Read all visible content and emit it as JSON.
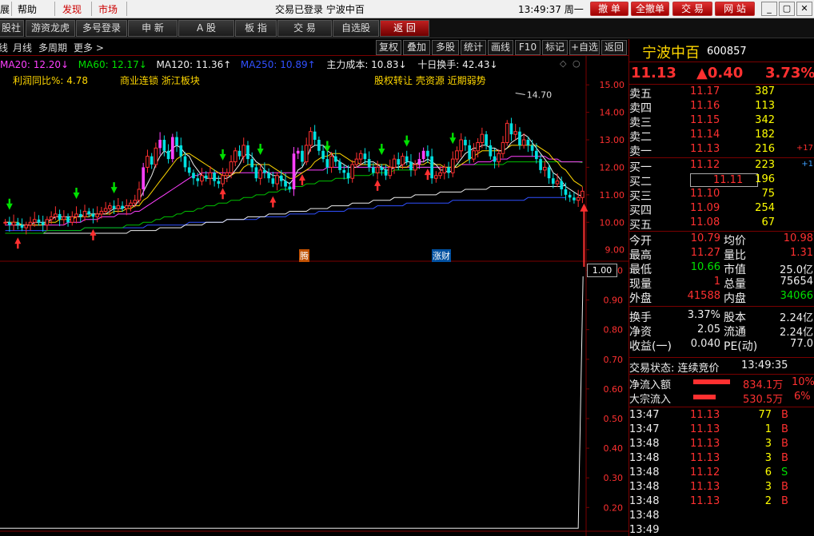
{
  "menu": {
    "items": [
      "展",
      "帮助",
      "发现",
      "市场"
    ],
    "window_title": "交易已登录  宁波中百",
    "clock": "13:49:37 周一",
    "trade_buttons": [
      "撤 单",
      "全撤单",
      "交 易",
      "网 站"
    ],
    "window_controls": [
      "_",
      "▢",
      "✕"
    ]
  },
  "toolbar": {
    "buttons": [
      "股社",
      "游资龙虎",
      "多号登录",
      "申 新",
      "A 股",
      "板 指",
      "交 易",
      "自选股",
      "返 回"
    ],
    "active_index": 8
  },
  "chart_toolbar": {
    "period_items": [
      "线",
      "月线",
      "多周期",
      "更多 >"
    ],
    "tool_buttons": [
      "复权",
      "叠加",
      "多股",
      "统计",
      "画线",
      "F10",
      "标记",
      "+自选",
      "返回"
    ]
  },
  "ma_legend": [
    {
      "text": "MA20: 12.20↓",
      "color": "#ff40ff"
    },
    {
      "text": "MA60: 12.17↓",
      "color": "#00e000"
    },
    {
      "text": "MA120: 11.36↑",
      "color": "#eeeeee"
    },
    {
      "text": "MA250: 10.89↑",
      "color": "#3050ff"
    },
    {
      "text": "主力成本: 10.83↓",
      "color": "#eeeeee"
    },
    {
      "text": "十日换手: 42.43↓",
      "color": "#eeeeee"
    }
  ],
  "info_line": {
    "left": "利润同比%: 4.78",
    "middle": "商业连锁 浙江板块",
    "right": "股权转让 壳资源 近期弱势"
  },
  "peak_label": "14.70",
  "price_axis": [
    "15.00",
    "14.00",
    "13.00",
    "12.00",
    "11.00",
    "10.00",
    "9.00"
  ],
  "lower_axis": [
    "1.00",
    "0.90",
    "0.80",
    "0.70",
    "0.60",
    "0.50",
    "0.40",
    "0.30",
    "0.20"
  ],
  "lower_axis_current": "1.00",
  "event_tags": [
    "腾",
    "涨财"
  ],
  "chart_data": {
    "type": "line",
    "title": "",
    "price_range": [
      8.7,
      15.5
    ],
    "x": [
      "d1",
      "d2",
      "d3",
      "d4",
      "d5",
      "d6",
      "d7",
      "d8",
      "d9",
      "d10",
      "d11",
      "d12",
      "d13",
      "d14",
      "d15",
      "d16",
      "d17",
      "d18",
      "d19",
      "d20",
      "d21",
      "d22",
      "d23",
      "d24",
      "d25",
      "d26",
      "d27",
      "d28",
      "d29",
      "d30",
      "d31",
      "d32",
      "d33",
      "d34",
      "d35",
      "d36",
      "d37",
      "d38",
      "d39",
      "d40",
      "d41",
      "d42",
      "d43",
      "d44",
      "d45",
      "d46",
      "d47",
      "d48",
      "d49",
      "d50",
      "d51",
      "d52",
      "d53",
      "d54",
      "d55",
      "d56",
      "d57",
      "d58",
      "d59",
      "d60",
      "d61",
      "d62",
      "d63",
      "d64",
      "d65",
      "d66",
      "d67",
      "d68",
      "d69",
      "d70",
      "d71",
      "d72",
      "d73",
      "d74",
      "d75",
      "d76",
      "d77",
      "d78",
      "d79",
      "d80",
      "d81",
      "d82",
      "d83",
      "d84",
      "d85",
      "d86",
      "d87",
      "d88",
      "d89",
      "d90",
      "d91",
      "d92",
      "d93",
      "d94",
      "d95",
      "d96",
      "d97",
      "d98",
      "d99",
      "d100",
      "d101",
      "d102",
      "d103",
      "d104",
      "d105",
      "d106",
      "d107",
      "d108",
      "d109",
      "d110",
      "d111",
      "d112",
      "d113",
      "d114",
      "d115",
      "d116",
      "d117",
      "d118",
      "d119",
      "d120",
      "d121",
      "d122",
      "d123",
      "d124",
      "d125",
      "d126",
      "d127",
      "d128",
      "d129",
      "d130",
      "d131",
      "d132",
      "d133",
      "d134",
      "d135",
      "d136",
      "d137",
      "d138",
      "d139"
    ],
    "close": [
      10.0,
      9.9,
      10.0,
      9.9,
      9.8,
      9.9,
      10.0,
      10.1,
      10.0,
      9.9,
      10.1,
      10.2,
      10.3,
      10.1,
      10.2,
      10.0,
      10.2,
      10.3,
      10.2,
      10.4,
      10.3,
      10.2,
      10.3,
      10.4,
      10.5,
      10.6,
      10.5,
      10.6,
      10.5,
      10.6,
      10.7,
      10.8,
      11.2,
      12.0,
      12.4,
      12.1,
      12.7,
      13.0,
      12.6,
      12.3,
      13.1,
      12.8,
      12.4,
      12.0,
      11.8,
      11.6,
      11.5,
      11.7,
      11.6,
      11.8,
      11.5,
      11.4,
      11.7,
      11.8,
      12.2,
      12.6,
      12.4,
      12.8,
      12.3,
      12.0,
      11.6,
      11.9,
      11.8,
      11.6,
      11.4,
      11.7,
      11.5,
      11.3,
      11.2,
      12.5,
      12.6,
      12.2,
      12.8,
      13.3,
      13.0,
      12.6,
      12.3,
      12.0,
      12.4,
      12.2,
      11.9,
      11.8,
      11.6,
      12.1,
      12.3,
      12.5,
      12.3,
      12.0,
      11.8,
      12.0,
      11.9,
      11.7,
      12.0,
      12.3,
      12.1,
      12.4,
      12.2,
      11.9,
      12.1,
      12.3,
      12.6,
      12.4,
      11.6,
      11.7,
      11.8,
      12.0,
      11.8,
      12.3,
      12.6,
      13.0,
      12.8,
      12.3,
      12.6,
      12.9,
      13.2,
      12.8,
      12.4,
      12.2,
      12.5,
      12.9,
      13.6,
      13.2,
      13.3,
      12.8,
      13.0,
      12.8,
      12.6,
      12.3,
      11.9,
      12.0,
      11.6,
      11.4,
      11.5,
      11.2,
      11.0,
      10.9,
      10.8,
      10.9,
      11.13
    ],
    "limit_up_days": [
      33,
      37,
      40,
      69,
      70,
      99,
      100
    ],
    "ma5": [
      10.0,
      10.0,
      9.9,
      9.9,
      9.9,
      9.9,
      9.9,
      10.0,
      10.0,
      10.0,
      10.0,
      10.1,
      10.2,
      10.2,
      10.2,
      10.2,
      10.2,
      10.2,
      10.2,
      10.3,
      10.3,
      10.3,
      10.3,
      10.3,
      10.3,
      10.4,
      10.5,
      10.5,
      10.5,
      10.6,
      10.6,
      10.6,
      10.8,
      11.1,
      11.4,
      11.7,
      12.1,
      12.4,
      12.6,
      12.5,
      12.7,
      12.8,
      12.7,
      12.5,
      12.4,
      12.1,
      11.9,
      11.7,
      11.6,
      11.6,
      11.6,
      11.6,
      11.6,
      11.6,
      11.7,
      11.9,
      12.1,
      12.4,
      12.5,
      12.4,
      12.2,
      12.1,
      11.9,
      11.8,
      11.7,
      11.7,
      11.6,
      11.5,
      11.4,
      11.6,
      11.9,
      12.0,
      12.3,
      12.7,
      12.8,
      12.8,
      12.8,
      12.6,
      12.5,
      12.3,
      12.2,
      12.1,
      12.0,
      12.0,
      12.0,
      12.1,
      12.2,
      12.2,
      12.2,
      12.1,
      12.0,
      11.9,
      11.9,
      12.0,
      12.0,
      12.1,
      12.2,
      12.2,
      12.1,
      12.2,
      12.2,
      12.3,
      12.2,
      12.1,
      11.9,
      11.9,
      11.8,
      11.9,
      12.1,
      12.3,
      12.5,
      12.6,
      12.7,
      12.7,
      12.8,
      12.8,
      12.7,
      12.7,
      12.6,
      12.6,
      12.7,
      12.9,
      13.0,
      13.1,
      13.2,
      13.1,
      12.9,
      12.7,
      12.5,
      12.3,
      12.1,
      11.8,
      11.7,
      11.5,
      11.3,
      11.2,
      11.1,
      11.0,
      10.95
    ],
    "ma10": [
      10.0,
      10.0,
      10.0,
      10.0,
      9.9,
      9.9,
      9.9,
      9.9,
      9.9,
      9.9,
      10.0,
      10.0,
      10.0,
      10.1,
      10.1,
      10.1,
      10.1,
      10.2,
      10.2,
      10.2,
      10.2,
      10.3,
      10.3,
      10.3,
      10.3,
      10.3,
      10.4,
      10.4,
      10.4,
      10.5,
      10.5,
      10.6,
      10.6,
      10.8,
      10.9,
      11.1,
      11.3,
      11.5,
      11.7,
      11.9,
      12.1,
      12.3,
      12.4,
      12.5,
      12.5,
      12.4,
      12.3,
      12.2,
      12.1,
      12.0,
      11.9,
      11.8,
      11.7,
      11.7,
      11.7,
      11.8,
      11.8,
      12.0,
      12.1,
      12.1,
      12.1,
      12.1,
      12.1,
      12.1,
      12.0,
      11.9,
      11.8,
      11.7,
      11.6,
      11.6,
      11.7,
      11.8,
      11.9,
      12.0,
      12.2,
      12.3,
      12.4,
      12.4,
      12.5,
      12.5,
      12.5,
      12.4,
      12.3,
      12.2,
      12.2,
      12.1,
      12.1,
      12.1,
      12.1,
      12.1,
      12.1,
      12.1,
      12.0,
      12.0,
      12.0,
      12.0,
      12.0,
      12.1,
      12.1,
      12.1,
      12.1,
      12.2,
      12.1,
      12.1,
      12.1,
      12.0,
      12.0,
      12.0,
      12.0,
      12.1,
      12.2,
      12.3,
      12.4,
      12.5,
      12.6,
      12.6,
      12.6,
      12.6,
      12.6,
      12.6,
      12.7,
      12.8,
      12.8,
      12.8,
      12.8,
      12.8,
      12.8,
      12.8,
      12.7,
      12.6,
      12.5,
      12.3,
      12.2,
      12.0,
      11.9,
      11.7,
      11.5,
      11.4,
      11.3
    ],
    "ma20": [
      9.9,
      9.9,
      9.9,
      9.9,
      9.9,
      9.9,
      9.9,
      9.9,
      9.9,
      9.9,
      9.9,
      9.9,
      9.9,
      9.9,
      9.9,
      10.0,
      10.0,
      10.0,
      10.0,
      10.1,
      10.1,
      10.1,
      10.1,
      10.2,
      10.2,
      10.2,
      10.2,
      10.3,
      10.3,
      10.3,
      10.3,
      10.4,
      10.4,
      10.5,
      10.6,
      10.7,
      10.8,
      10.9,
      11.0,
      11.1,
      11.2,
      11.3,
      11.4,
      11.5,
      11.6,
      11.7,
      11.7,
      11.8,
      11.8,
      11.8,
      11.8,
      11.8,
      11.8,
      11.8,
      11.8,
      11.8,
      11.8,
      11.8,
      11.8,
      11.8,
      11.8,
      11.8,
      11.8,
      11.8,
      11.8,
      11.8,
      11.8,
      11.8,
      11.8,
      11.8,
      11.8,
      11.8,
      11.9,
      11.9,
      11.9,
      11.9,
      11.9,
      12.0,
      12.0,
      12.0,
      12.0,
      12.0,
      12.0,
      12.0,
      12.0,
      12.0,
      12.0,
      12.0,
      12.0,
      12.0,
      12.0,
      12.0,
      12.0,
      12.0,
      12.0,
      12.0,
      12.0,
      12.0,
      12.0,
      12.0,
      12.0,
      12.0,
      12.0,
      12.0,
      12.0,
      12.0,
      12.0,
      12.0,
      12.0,
      12.1,
      12.1,
      12.1,
      12.1,
      12.2,
      12.2,
      12.2,
      12.2,
      12.3,
      12.3,
      12.3,
      12.3,
      12.4,
      12.4,
      12.4,
      12.4,
      12.4,
      12.4,
      12.4,
      12.4,
      12.4,
      12.3,
      12.3,
      12.3,
      12.2,
      12.2,
      12.2,
      12.2,
      12.2,
      12.2
    ],
    "ma60": [
      9.6,
      9.6,
      9.6,
      9.6,
      9.6,
      9.6,
      9.6,
      9.6,
      9.6,
      9.6,
      9.7,
      9.7,
      9.7,
      9.7,
      9.7,
      9.7,
      9.7,
      9.7,
      9.7,
      9.8,
      9.8,
      9.8,
      9.8,
      9.8,
      9.8,
      9.8,
      9.8,
      9.8,
      9.8,
      9.9,
      9.9,
      9.9,
      9.9,
      10.0,
      10.0,
      10.0,
      10.1,
      10.1,
      10.2,
      10.2,
      10.2,
      10.3,
      10.3,
      10.4,
      10.4,
      10.4,
      10.5,
      10.5,
      10.6,
      10.6,
      10.6,
      10.7,
      10.7,
      10.7,
      10.8,
      10.8,
      10.8,
      10.9,
      10.9,
      10.9,
      11.0,
      11.0,
      11.0,
      11.1,
      11.1,
      11.1,
      11.2,
      11.2,
      11.2,
      11.3,
      11.3,
      11.3,
      11.4,
      11.4,
      11.4,
      11.5,
      11.5,
      11.5,
      11.5,
      11.6,
      11.6,
      11.6,
      11.6,
      11.7,
      11.7,
      11.7,
      11.7,
      11.7,
      11.8,
      11.8,
      11.8,
      11.8,
      11.8,
      11.9,
      11.9,
      11.9,
      11.9,
      11.9,
      11.9,
      12.0,
      12.0,
      12.0,
      12.0,
      12.0,
      12.0,
      12.0,
      12.0,
      12.0,
      12.1,
      12.1,
      12.1,
      12.1,
      12.1,
      12.1,
      12.1,
      12.1,
      12.1,
      12.1,
      12.1,
      12.1,
      12.2,
      12.2,
      12.2,
      12.2,
      12.2,
      12.2,
      12.2,
      12.2,
      12.2,
      12.2,
      12.2,
      12.2,
      12.2,
      12.2,
      12.2,
      12.2,
      12.2,
      12.2,
      12.17
    ],
    "ma120": [
      9.6,
      9.6,
      9.6,
      9.6,
      9.6,
      9.6,
      9.6,
      9.6,
      9.6,
      9.6,
      9.6,
      9.6,
      9.6,
      9.6,
      9.6,
      9.6,
      9.6,
      9.6,
      9.6,
      9.6,
      9.6,
      9.6,
      9.6,
      9.6,
      9.6,
      9.6,
      9.6,
      9.6,
      9.6,
      9.6,
      9.7,
      9.7,
      9.7,
      9.7,
      9.7,
      9.7,
      9.7,
      9.8,
      9.8,
      9.8,
      9.8,
      9.8,
      9.8,
      9.9,
      9.9,
      9.9,
      9.9,
      9.9,
      10.0,
      10.0,
      10.0,
      10.0,
      10.0,
      10.1,
      10.1,
      10.1,
      10.1,
      10.1,
      10.2,
      10.2,
      10.2,
      10.2,
      10.2,
      10.3,
      10.3,
      10.3,
      10.3,
      10.3,
      10.4,
      10.4,
      10.4,
      10.4,
      10.4,
      10.5,
      10.5,
      10.5,
      10.5,
      10.5,
      10.6,
      10.6,
      10.6,
      10.6,
      10.6,
      10.7,
      10.7,
      10.7,
      10.7,
      10.7,
      10.8,
      10.8,
      10.8,
      10.8,
      10.8,
      10.9,
      10.9,
      10.9,
      10.9,
      10.9,
      11.0,
      11.0,
      11.0,
      11.0,
      11.0,
      11.0,
      11.1,
      11.1,
      11.1,
      11.1,
      11.1,
      11.1,
      11.2,
      11.2,
      11.2,
      11.2,
      11.2,
      11.2,
      11.3,
      11.3,
      11.3,
      11.3,
      11.3,
      11.3,
      11.3,
      11.3,
      11.3,
      11.3,
      11.3,
      11.3,
      11.3,
      11.3,
      11.3,
      11.3,
      11.3,
      11.3,
      11.36
    ],
    "ma250": [
      9.7,
      9.7,
      9.7,
      9.7,
      9.7,
      9.7,
      9.7,
      9.7,
      9.7,
      9.7,
      9.7,
      9.7,
      9.7,
      9.7,
      9.7,
      9.7,
      9.7,
      9.7,
      9.7,
      9.8,
      9.8,
      9.8,
      9.8,
      9.8,
      9.8,
      9.8,
      9.8,
      9.8,
      9.8,
      9.8,
      9.8,
      9.8,
      9.8,
      9.8,
      9.9,
      9.9,
      9.9,
      9.9,
      9.9,
      9.9,
      9.9,
      9.9,
      9.9,
      9.9,
      10.0,
      10.0,
      10.0,
      10.0,
      10.0,
      10.0,
      10.0,
      10.0,
      10.0,
      10.1,
      10.1,
      10.1,
      10.1,
      10.1,
      10.1,
      10.1,
      10.1,
      10.2,
      10.2,
      10.2,
      10.2,
      10.2,
      10.2,
      10.2,
      10.3,
      10.3,
      10.3,
      10.3,
      10.3,
      10.3,
      10.3,
      10.4,
      10.4,
      10.4,
      10.4,
      10.4,
      10.4,
      10.4,
      10.5,
      10.5,
      10.5,
      10.5,
      10.5,
      10.5,
      10.5,
      10.6,
      10.6,
      10.6,
      10.6,
      10.6,
      10.6,
      10.6,
      10.7,
      10.7,
      10.7,
      10.7,
      10.7,
      10.7,
      10.7,
      10.7,
      10.7,
      10.7,
      10.7,
      10.8,
      10.8,
      10.8,
      10.8,
      10.8,
      10.8,
      10.8,
      10.8,
      10.8,
      10.8,
      10.8,
      10.8,
      10.8,
      10.8,
      10.8,
      10.8,
      10.8,
      10.8,
      10.9,
      10.9,
      10.9,
      10.9,
      10.9,
      10.9,
      10.9,
      10.9,
      10.9,
      10.89
    ],
    "lower_indicator": {
      "range": [
        0.12,
        1.02
      ],
      "flat_value": 0.13,
      "spike_to": 0.98
    }
  },
  "quote": {
    "name": "宁波中百",
    "code": "600857",
    "price": "11.13",
    "change": "▲0.40",
    "change_pct": "3.73%"
  },
  "order_book": {
    "sell": [
      {
        "label": "卖五",
        "price": "11.17",
        "vol": "387",
        "delta": ""
      },
      {
        "label": "卖四",
        "price": "11.16",
        "vol": "113",
        "delta": ""
      },
      {
        "label": "卖三",
        "price": "11.15",
        "vol": "342",
        "delta": ""
      },
      {
        "label": "卖二",
        "price": "11.14",
        "vol": "182",
        "delta": ""
      },
      {
        "label": "卖一",
        "price": "11.13",
        "vol": "216",
        "delta": "+17"
      }
    ],
    "buy": [
      {
        "label": "买一",
        "price": "11.12",
        "vol": "223",
        "delta": "+1"
      },
      {
        "label": "买二",
        "price": "11.11",
        "vol": "196",
        "delta": ""
      },
      {
        "label": "买三",
        "price": "11.10",
        "vol": "75",
        "delta": ""
      },
      {
        "label": "买四",
        "price": "11.09",
        "vol": "254",
        "delta": ""
      },
      {
        "label": "买五",
        "price": "11.08",
        "vol": "67",
        "delta": ""
      }
    ]
  },
  "stats": [
    {
      "l1": "今开",
      "v1": "10.79",
      "c1": "red",
      "l2": "均价",
      "v2": "10.98",
      "c2": "red"
    },
    {
      "l1": "最高",
      "v1": "11.27",
      "c1": "red",
      "l2": "量比",
      "v2": "1.31",
      "c2": "red"
    },
    {
      "l1": "最低",
      "v1": "10.66",
      "c1": "green",
      "l2": "市值",
      "v2": "25.0亿",
      "c2": "white"
    },
    {
      "l1": "现量",
      "v1": "1",
      "c1": "red",
      "l2": "总量",
      "v2": "75654",
      "c2": "white"
    },
    {
      "l1": "外盘",
      "v1": "41588",
      "c1": "red",
      "l2": "内盘",
      "v2": "34066",
      "c2": "green"
    },
    {
      "l1": "换手",
      "v1": "3.37%",
      "c1": "white",
      "l2": "股本",
      "v2": "2.24亿",
      "c2": "white"
    },
    {
      "l1": "净资",
      "v1": "2.05",
      "c1": "white",
      "l2": "流通",
      "v2": "2.24亿",
      "c2": "white"
    },
    {
      "l1": "收益(一)",
      "v1": "0.040",
      "c1": "white",
      "l2": "PE(动)",
      "v2": "77.0",
      "c2": "white"
    }
  ],
  "trade_status": {
    "label": "交易状态: 连续竞价",
    "time": "13:49:35"
  },
  "fund_flow": [
    {
      "label": "净流入额",
      "value": "834.1万",
      "pct": "10%"
    },
    {
      "label": "大宗流入",
      "value": "530.5万",
      "pct": "6%"
    }
  ],
  "ticks": [
    {
      "time": "13:47",
      "price": "11.13",
      "vol": "77",
      "side": "B"
    },
    {
      "time": "13:47",
      "price": "11.13",
      "vol": "1",
      "side": "B"
    },
    {
      "time": "13:48",
      "price": "11.13",
      "vol": "3",
      "side": "B"
    },
    {
      "time": "13:48",
      "price": "11.13",
      "vol": "3",
      "side": "B"
    },
    {
      "time": "13:48",
      "price": "11.12",
      "vol": "6",
      "side": "S"
    },
    {
      "time": "13:48",
      "price": "11.13",
      "vol": "3",
      "side": "B"
    },
    {
      "time": "13:48",
      "price": "11.13",
      "vol": "2",
      "side": "B"
    },
    {
      "time": "13:48",
      "price": "",
      "vol": "",
      "side": ""
    },
    {
      "time": "13:49",
      "price": "",
      "vol": "",
      "side": ""
    }
  ],
  "colors": {
    "up": "#ff3030",
    "down": "#00e0e0",
    "flat": "#eeeeee",
    "grid": "#7a0000"
  }
}
